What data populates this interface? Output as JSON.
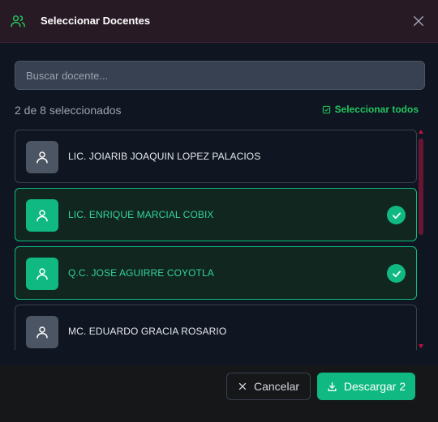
{
  "header": {
    "title": "Seleccionar Docentes",
    "icon": "users-icon",
    "close_icon": "close-icon"
  },
  "search": {
    "placeholder": "Buscar docente...",
    "value": ""
  },
  "selection": {
    "count_text": "2 de 8 seleccionados",
    "select_all_label": "Seleccionar todos"
  },
  "teachers": [
    {
      "name": "LIC. JOIARIB JOAQUIN LOPEZ PALACIOS",
      "selected": false
    },
    {
      "name": "LIC. ENRIQUE MARCIAL COBIX",
      "selected": true
    },
    {
      "name": "Q.C. JOSE AGUIRRE COYOTLA",
      "selected": true
    },
    {
      "name": "MC. EDUARDO GRACIA ROSARIO",
      "selected": false
    }
  ],
  "footer": {
    "cancel_label": "Cancelar",
    "download_label": "Descargar 2"
  },
  "colors": {
    "accent": "#10b981",
    "header_bg": "#281a25",
    "scrollbar": "#6b1534"
  }
}
